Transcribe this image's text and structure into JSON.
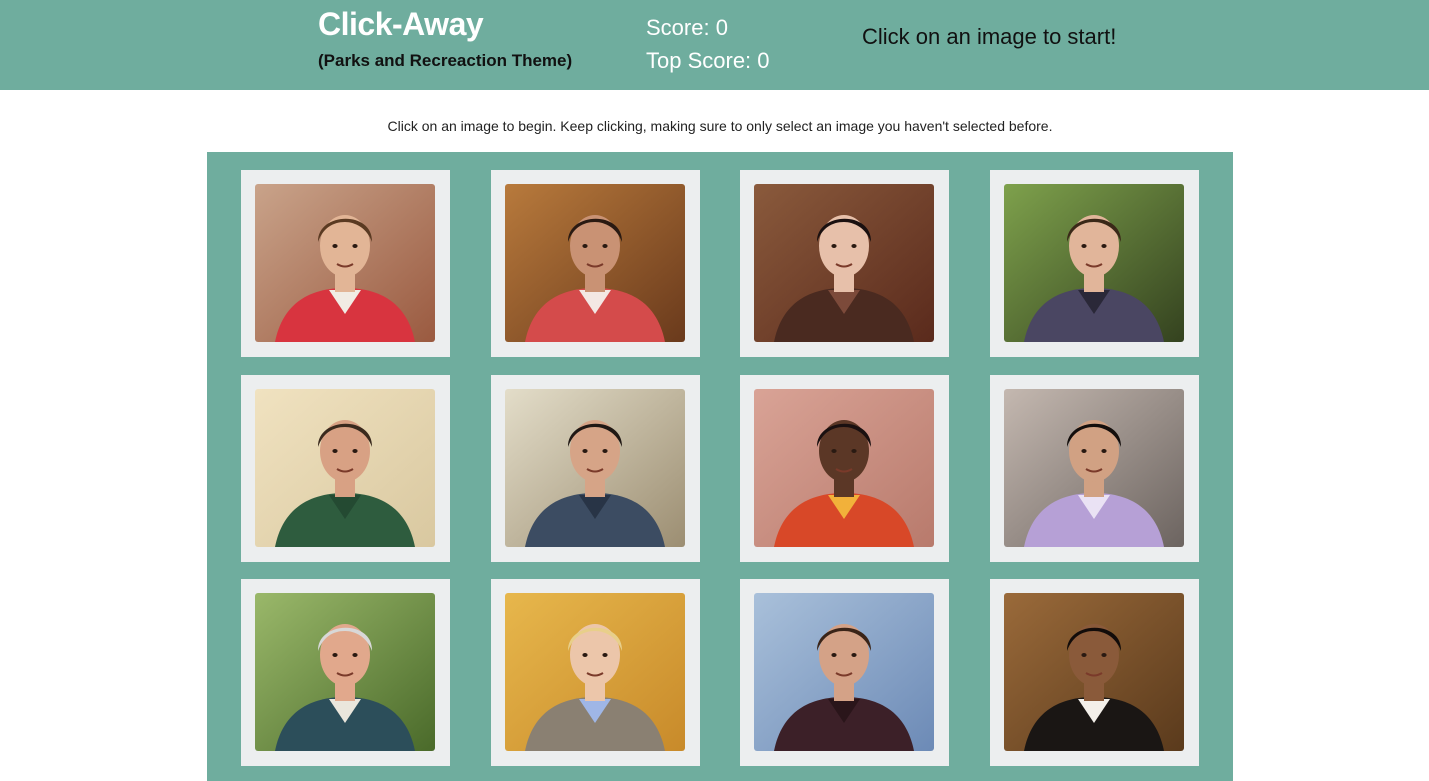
{
  "header": {
    "title": "Click-Away",
    "subtitle": "(Parks and Recreaction Theme)",
    "score_label": "Score: 0",
    "top_score_label": "Top Score: 0",
    "status_message": "Click on an image to start!"
  },
  "instructions": "Click on an image to begin. Keep clicking, making sure to only select an image you haven't selected before.",
  "colors": {
    "theme_teal": "#6fad9e",
    "card_background": "#eceeef"
  },
  "cards": [
    {
      "name": "andy-dwyer",
      "bg": "#9a5a40",
      "bg2": "#c9a38a",
      "skin": "#e2b596",
      "hair": "#5a3a22",
      "shirt": "#d8343f",
      "shirt2": "#f1ece4"
    },
    {
      "name": "ann-perkins",
      "bg": "#6a3a1c",
      "bg2": "#b87a3c",
      "skin": "#c99274",
      "hair": "#2a1a12",
      "shirt": "#d44b4b",
      "shirt2": "#f3e7e3"
    },
    {
      "name": "april-ludgate",
      "bg": "#5a2a1c",
      "bg2": "#8a5a3c",
      "skin": "#e7c0aa",
      "hair": "#1a1010",
      "shirt": "#4a2a20",
      "shirt2": "#7c4a3a"
    },
    {
      "name": "ben-wyatt",
      "bg": "#34421f",
      "bg2": "#7ea14c",
      "skin": "#e1b59a",
      "hair": "#3a2818",
      "shirt": "#4a4662",
      "shirt2": "#2a2838"
    },
    {
      "name": "chris-traeger",
      "bg": "#d9c8a0",
      "bg2": "#f0e2c0",
      "skin": "#d8a184",
      "hair": "#3a2a1e",
      "shirt": "#2e5c3e",
      "shirt2": "#244a32"
    },
    {
      "name": "jean-ralphio",
      "bg": "#9c8e72",
      "bg2": "#e3ddc9",
      "skin": "#d6a487",
      "hair": "#201814",
      "shirt": "#3c4c62",
      "shirt2": "#283446"
    },
    {
      "name": "donna-meagle",
      "bg": "#b87a6c",
      "bg2": "#d9a396",
      "skin": "#5b3726",
      "hair": "#1a1010",
      "shirt": "#d84828",
      "shirt2": "#f2b13a"
    },
    {
      "name": "tom-haverford-alt",
      "bg": "#6c6460",
      "bg2": "#c4b8b0",
      "skin": "#d1a183",
      "hair": "#140e0c",
      "shirt": "#b6a0d6",
      "shirt2": "#eae2f4"
    },
    {
      "name": "jerry-gergich",
      "bg": "#4a6a2a",
      "bg2": "#9ab86a",
      "skin": "#e1a88c",
      "hair": "#d8d8d8",
      "shirt": "#2c4e5a",
      "shirt2": "#eae6dc"
    },
    {
      "name": "leslie-knope",
      "bg": "#c88a2a",
      "bg2": "#e7b74c",
      "skin": "#ecc6aa",
      "hair": "#e8cf8a",
      "shirt": "#8a8072",
      "shirt2": "#9fb6e6"
    },
    {
      "name": "ron-swanson",
      "bg": "#6c8ab6",
      "bg2": "#a9c0da",
      "skin": "#d4a287",
      "hair": "#3a2418",
      "shirt": "#3c2028",
      "shirt2": "#2a151a"
    },
    {
      "name": "tom-haverford",
      "bg": "#5a3a1c",
      "bg2": "#9a6a3a",
      "skin": "#8a5a3a",
      "hair": "#120c0a",
      "shirt": "#1a1614",
      "shirt2": "#f4f0ea"
    }
  ]
}
